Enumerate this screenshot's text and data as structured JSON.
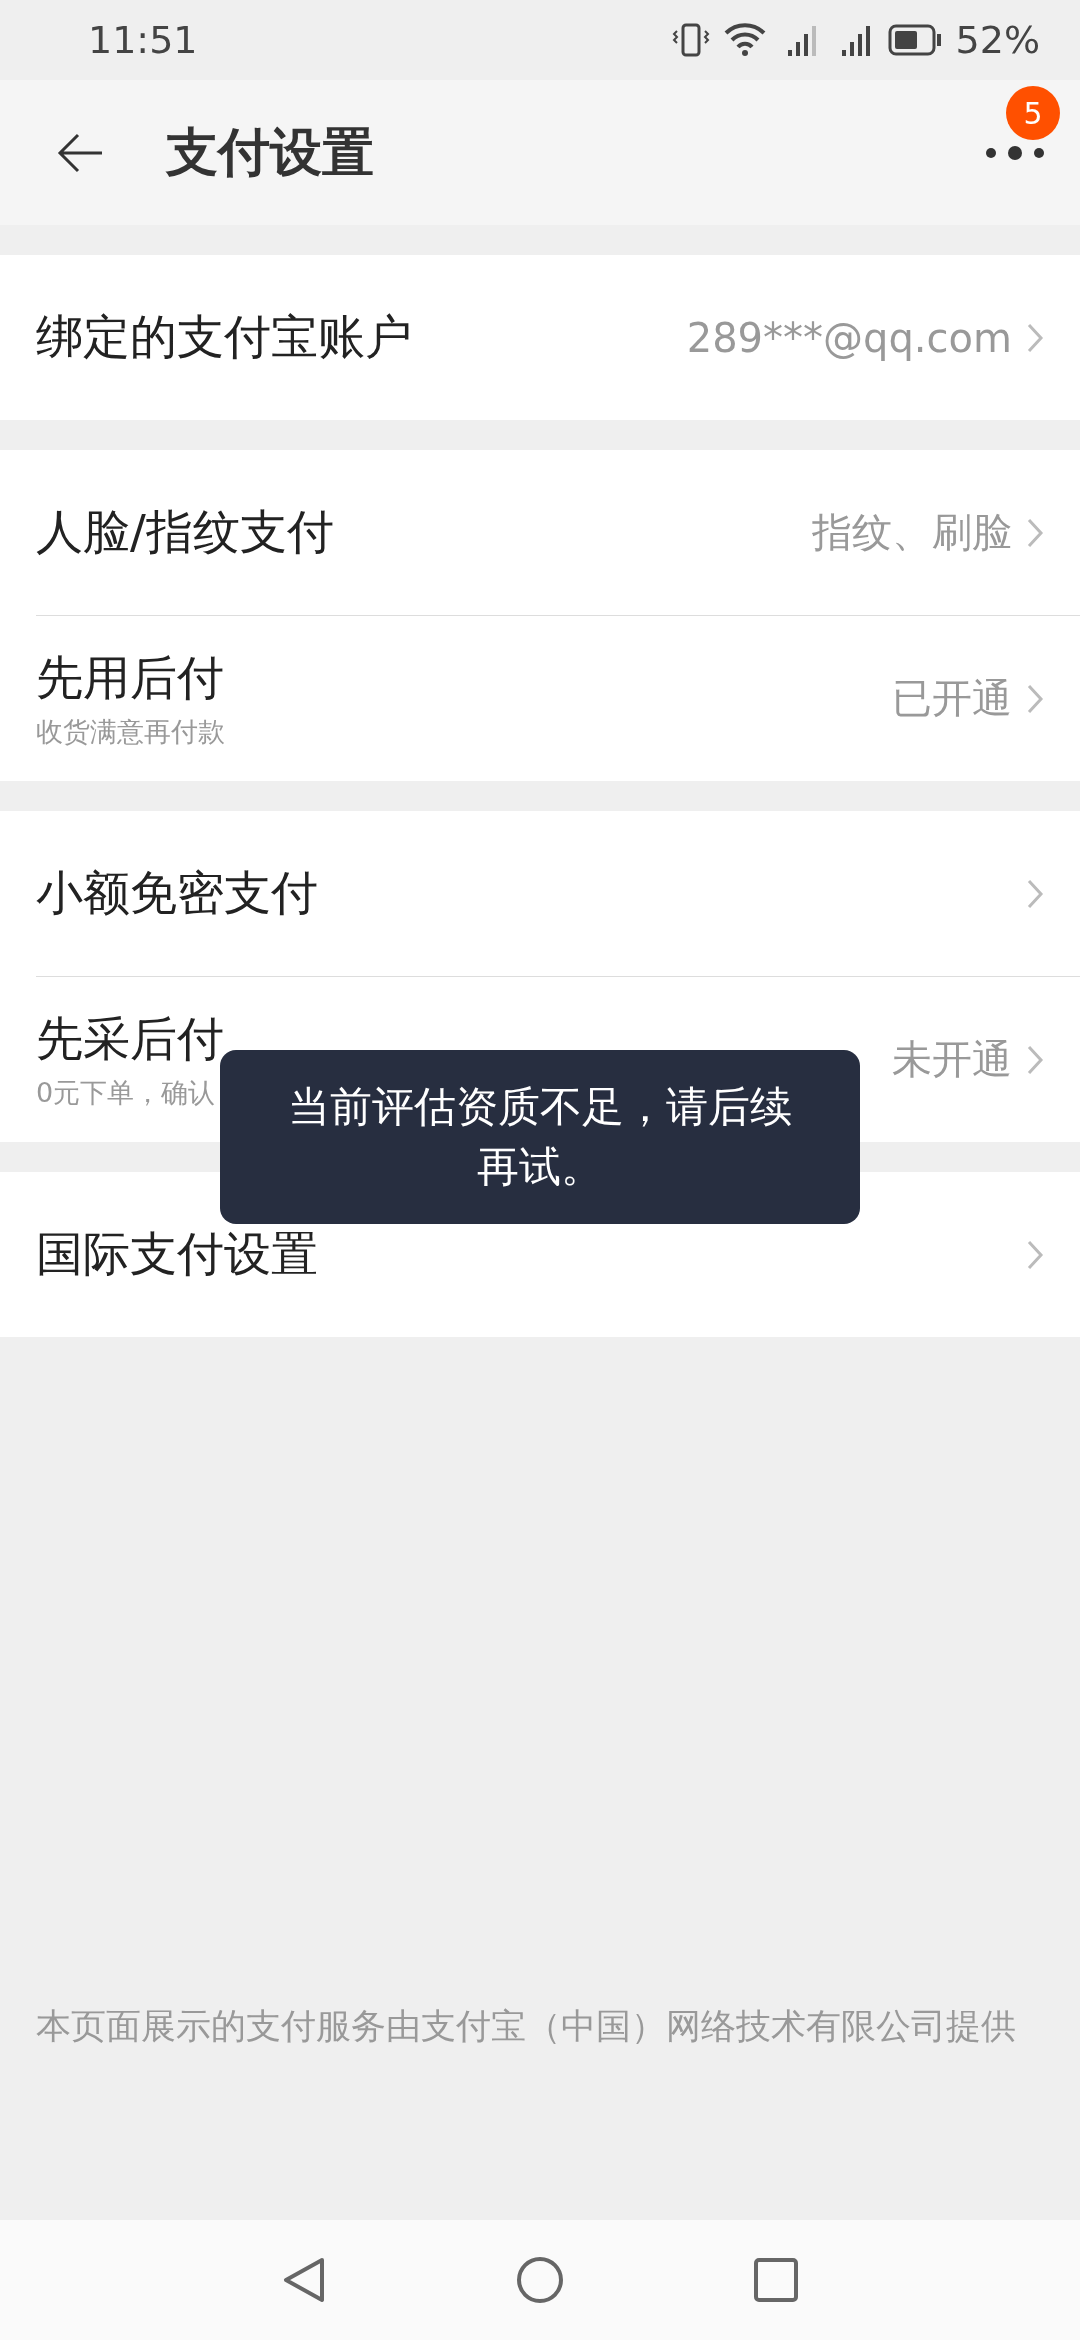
{
  "status_bar": {
    "time": "11:51",
    "battery_percent": "52%"
  },
  "header": {
    "title": "支付设置",
    "badge": "5"
  },
  "sections": [
    {
      "rows": [
        {
          "title": "绑定的支付宝账户",
          "value": "289***@qq.com"
        }
      ]
    },
    {
      "rows": [
        {
          "title": "人脸/指纹支付",
          "value": "指纹、刷脸"
        },
        {
          "title": "先用后付",
          "subtitle": "收货满意再付款",
          "value": "已开通"
        }
      ]
    },
    {
      "rows": [
        {
          "title": "小额免密支付"
        },
        {
          "title": "先采后付",
          "subtitle": "0元下单，确认",
          "value": "未开通"
        }
      ]
    },
    {
      "rows": [
        {
          "title": "国际支付设置"
        }
      ]
    }
  ],
  "footer": "本页面展示的支付服务由支付宝（中国）网络技术有限公司提供",
  "toast": "当前评估资质不足，请后续再试。"
}
